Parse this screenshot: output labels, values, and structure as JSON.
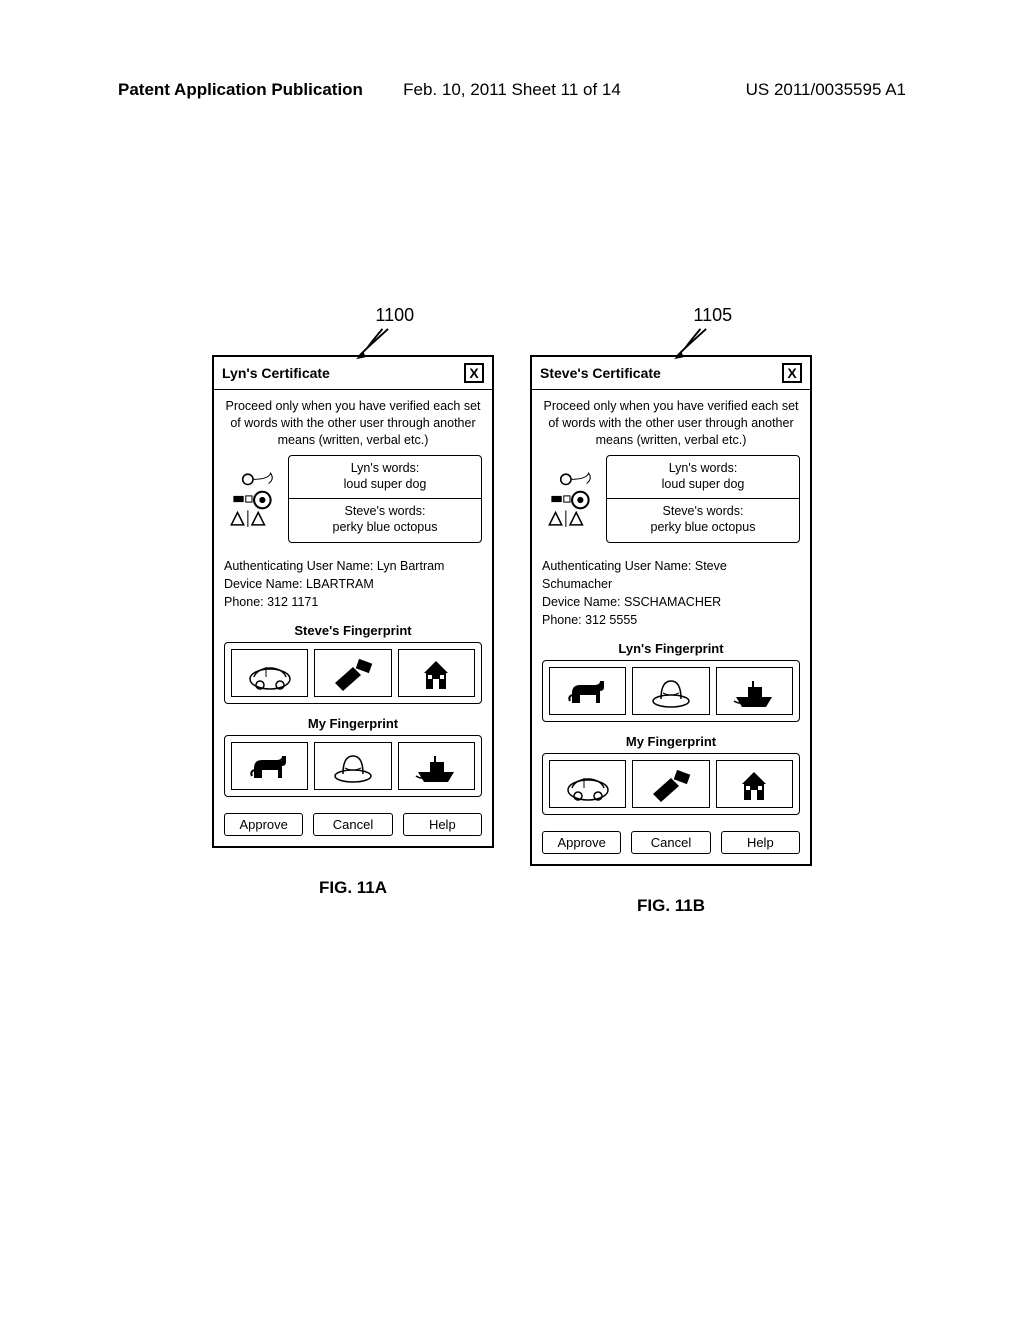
{
  "page_header": {
    "left": "Patent Application Publication",
    "center": "Feb. 10, 2011  Sheet 11 of 14",
    "right": "US 2011/0035595 A1"
  },
  "dialogs": [
    {
      "ref": "1100",
      "title": "Lyn's Certificate",
      "close_glyph": "X",
      "instructions": "Proceed only when you have verified each set of words with the other user through another means (written, verbal etc.)",
      "words": {
        "a_label": "Lyn's words:",
        "a_value": "loud super dog",
        "b_label": "Steve's words:",
        "b_value": "perky blue octopus"
      },
      "auth": {
        "user_line": "Authenticating User Name:  Lyn Bartram",
        "device_line": "Device Name:  LBARTRAM",
        "phone_line": "Phone: 312 1171"
      },
      "fp_other_heading": "Steve's Fingerprint",
      "fp_other_icons": [
        "car-icon",
        "hammer-icon",
        "house-icon"
      ],
      "fp_mine_heading": "My Fingerprint",
      "fp_mine_icons": [
        "dog-icon",
        "hat-icon",
        "ship-icon"
      ],
      "buttons": {
        "approve": "Approve",
        "cancel": "Cancel",
        "help": "Help"
      },
      "caption": "FIG. 11A"
    },
    {
      "ref": "1105",
      "title": "Steve's Certificate",
      "close_glyph": "X",
      "instructions": "Proceed only when you have verified each set of words with the other user through another means (written, verbal etc.)",
      "words": {
        "a_label": "Lyn's words:",
        "a_value": "loud super dog",
        "b_label": "Steve's words:",
        "b_value": "perky blue octopus"
      },
      "auth": {
        "user_line": "Authenticating User Name:  Steve Schumacher",
        "device_line": "Device Name:  SSCHAMACHER",
        "phone_line": "Phone: 312 5555"
      },
      "fp_other_heading": "Lyn's Fingerprint",
      "fp_other_icons": [
        "dog-icon",
        "hat-icon",
        "ship-icon"
      ],
      "fp_mine_heading": "My Fingerprint",
      "fp_mine_icons": [
        "car-icon",
        "hammer-icon",
        "house-icon"
      ],
      "buttons": {
        "approve": "Approve",
        "cancel": "Cancel",
        "help": "Help"
      },
      "caption": "FIG. 11B"
    }
  ]
}
